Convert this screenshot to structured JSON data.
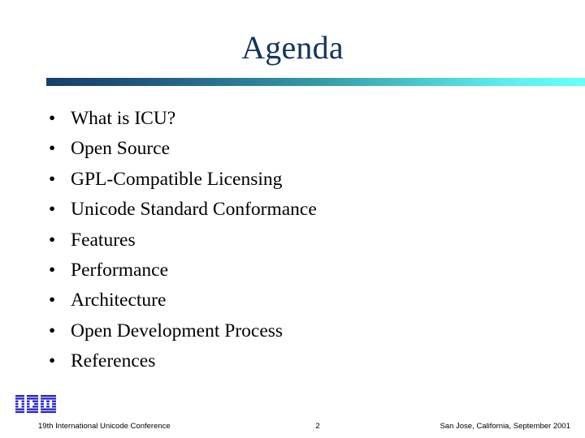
{
  "slide": {
    "title": "Agenda",
    "title_color": "#123560",
    "background_color": "#ffffff",
    "rule": {
      "gradient_start_color": "#15406b",
      "gradient_mid_color": "#3498a9",
      "gradient_end_color": "#66ffff"
    },
    "bullet_marker": "•",
    "bullets": [
      {
        "label": "What is ICU?"
      },
      {
        "label": "Open Source"
      },
      {
        "label": "GPL-Compatible Licensing"
      },
      {
        "label": "Unicode Standard Conformance"
      },
      {
        "label": "Features"
      },
      {
        "label": "Performance"
      },
      {
        "label": "Architecture"
      },
      {
        "label": "Open Development Process"
      },
      {
        "label": "References"
      }
    ]
  },
  "logo": {
    "name": "ibm-logo",
    "alt_text": "IBM",
    "color": "#2222CC"
  },
  "footer": {
    "left": "19th International Unicode Conference",
    "page_number": "2",
    "right": "San Jose, California, September 2001"
  }
}
